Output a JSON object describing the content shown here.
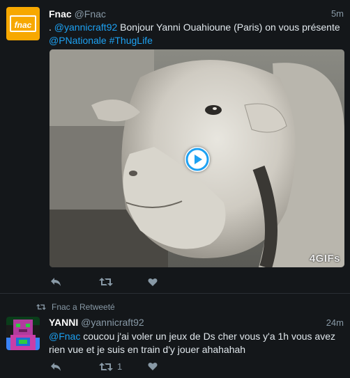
{
  "tweet1": {
    "name": "Fnac",
    "handle": "@Fnac",
    "time": "5m",
    "avatar_text": "fnac",
    "text_prefix": ". ",
    "mention": "@yannicraft92",
    "text_middle": " Bonjour Yanni Ouahioune (Paris) on vous présente ",
    "mention2": "@PNationale",
    "hashtag": "#ThugLife",
    "media_badge": "4GIFs",
    "colors": {
      "link": "#1da1f2",
      "background": "#14171a",
      "muted": "#8899a6"
    },
    "actions": [
      "reply-icon",
      "retweet-icon",
      "like-icon"
    ]
  },
  "tweet2": {
    "retweeted_by": "Fnac a Retweeté",
    "name": "YANNI",
    "handle": "@yannicraft92",
    "time": "24m",
    "mention": "@Fnac",
    "text": " coucou j'ai voler un jeux de Ds cher vous y'a 1h vous avez rien vue et je suis en train d'y jouer ahahahah",
    "retweet_count": "1",
    "actions": [
      "reply-icon",
      "retweet-icon",
      "like-icon"
    ]
  }
}
